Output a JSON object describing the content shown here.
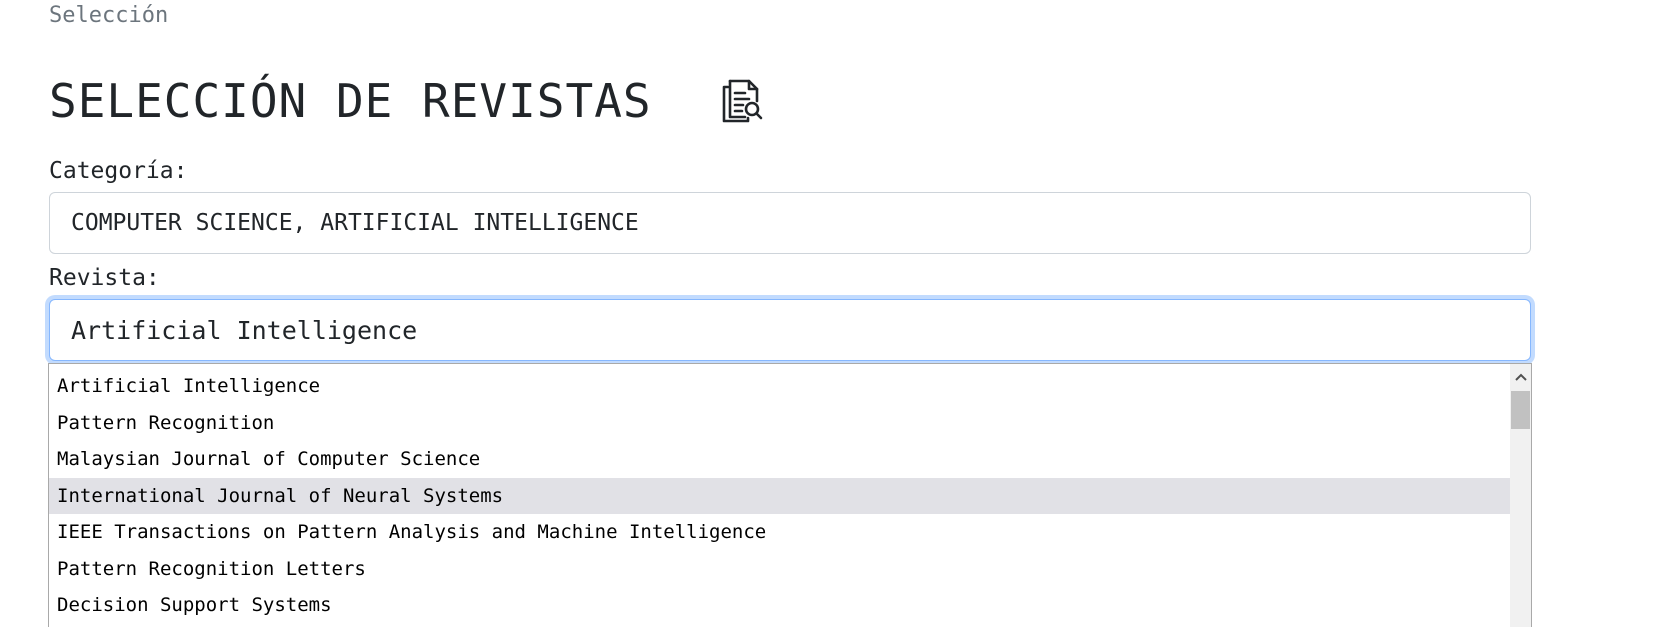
{
  "breadcrumb": "Selección",
  "page_title": "SELECCIÓN DE REVISTAS",
  "title_icon": "document-search-icon",
  "category": {
    "label": "Categoría:",
    "value": "COMPUTER SCIENCE, ARTIFICIAL INTELLIGENCE"
  },
  "journal": {
    "label": "Revista:",
    "value": "Artificial Intelligence"
  },
  "dropdown": {
    "highlighted_index": 3,
    "options": [
      "Artificial Intelligence",
      "Pattern Recognition",
      "Malaysian Journal of Computer Science",
      "International Journal of Neural Systems",
      "IEEE Transactions on Pattern Analysis and Machine Intelligence",
      "Pattern Recognition Letters",
      "Decision Support Systems"
    ]
  },
  "colors": {
    "focus_border": "#86b7fe",
    "highlight_row": "#e1e1e6",
    "muted_text": "#6c757d"
  }
}
